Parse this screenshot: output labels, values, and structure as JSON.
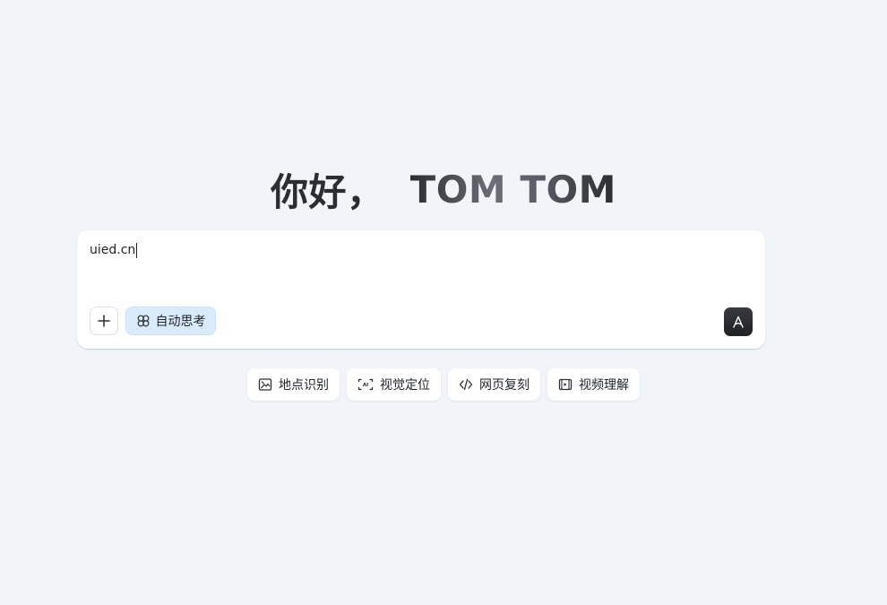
{
  "greeting": {
    "hello": "你好，",
    "name": "TOM TOM"
  },
  "chat": {
    "input_value": "uied.cn",
    "add_icon": "plus-icon",
    "think_label": "自动思考",
    "think_icon": "flower-icon",
    "send_icon": "send-logo-icon"
  },
  "quick_actions": [
    {
      "label": "地点识别",
      "icon": "image-location-icon"
    },
    {
      "label": "视觉定位",
      "icon": "scan-ai-icon"
    },
    {
      "label": "网页复刻",
      "icon": "code-icon"
    },
    {
      "label": "视频理解",
      "icon": "video-icon"
    }
  ],
  "colors": {
    "background": "#f1f4f8",
    "think_button_bg": "#d9ebfb",
    "send_button_bg": "#2b2c31"
  }
}
